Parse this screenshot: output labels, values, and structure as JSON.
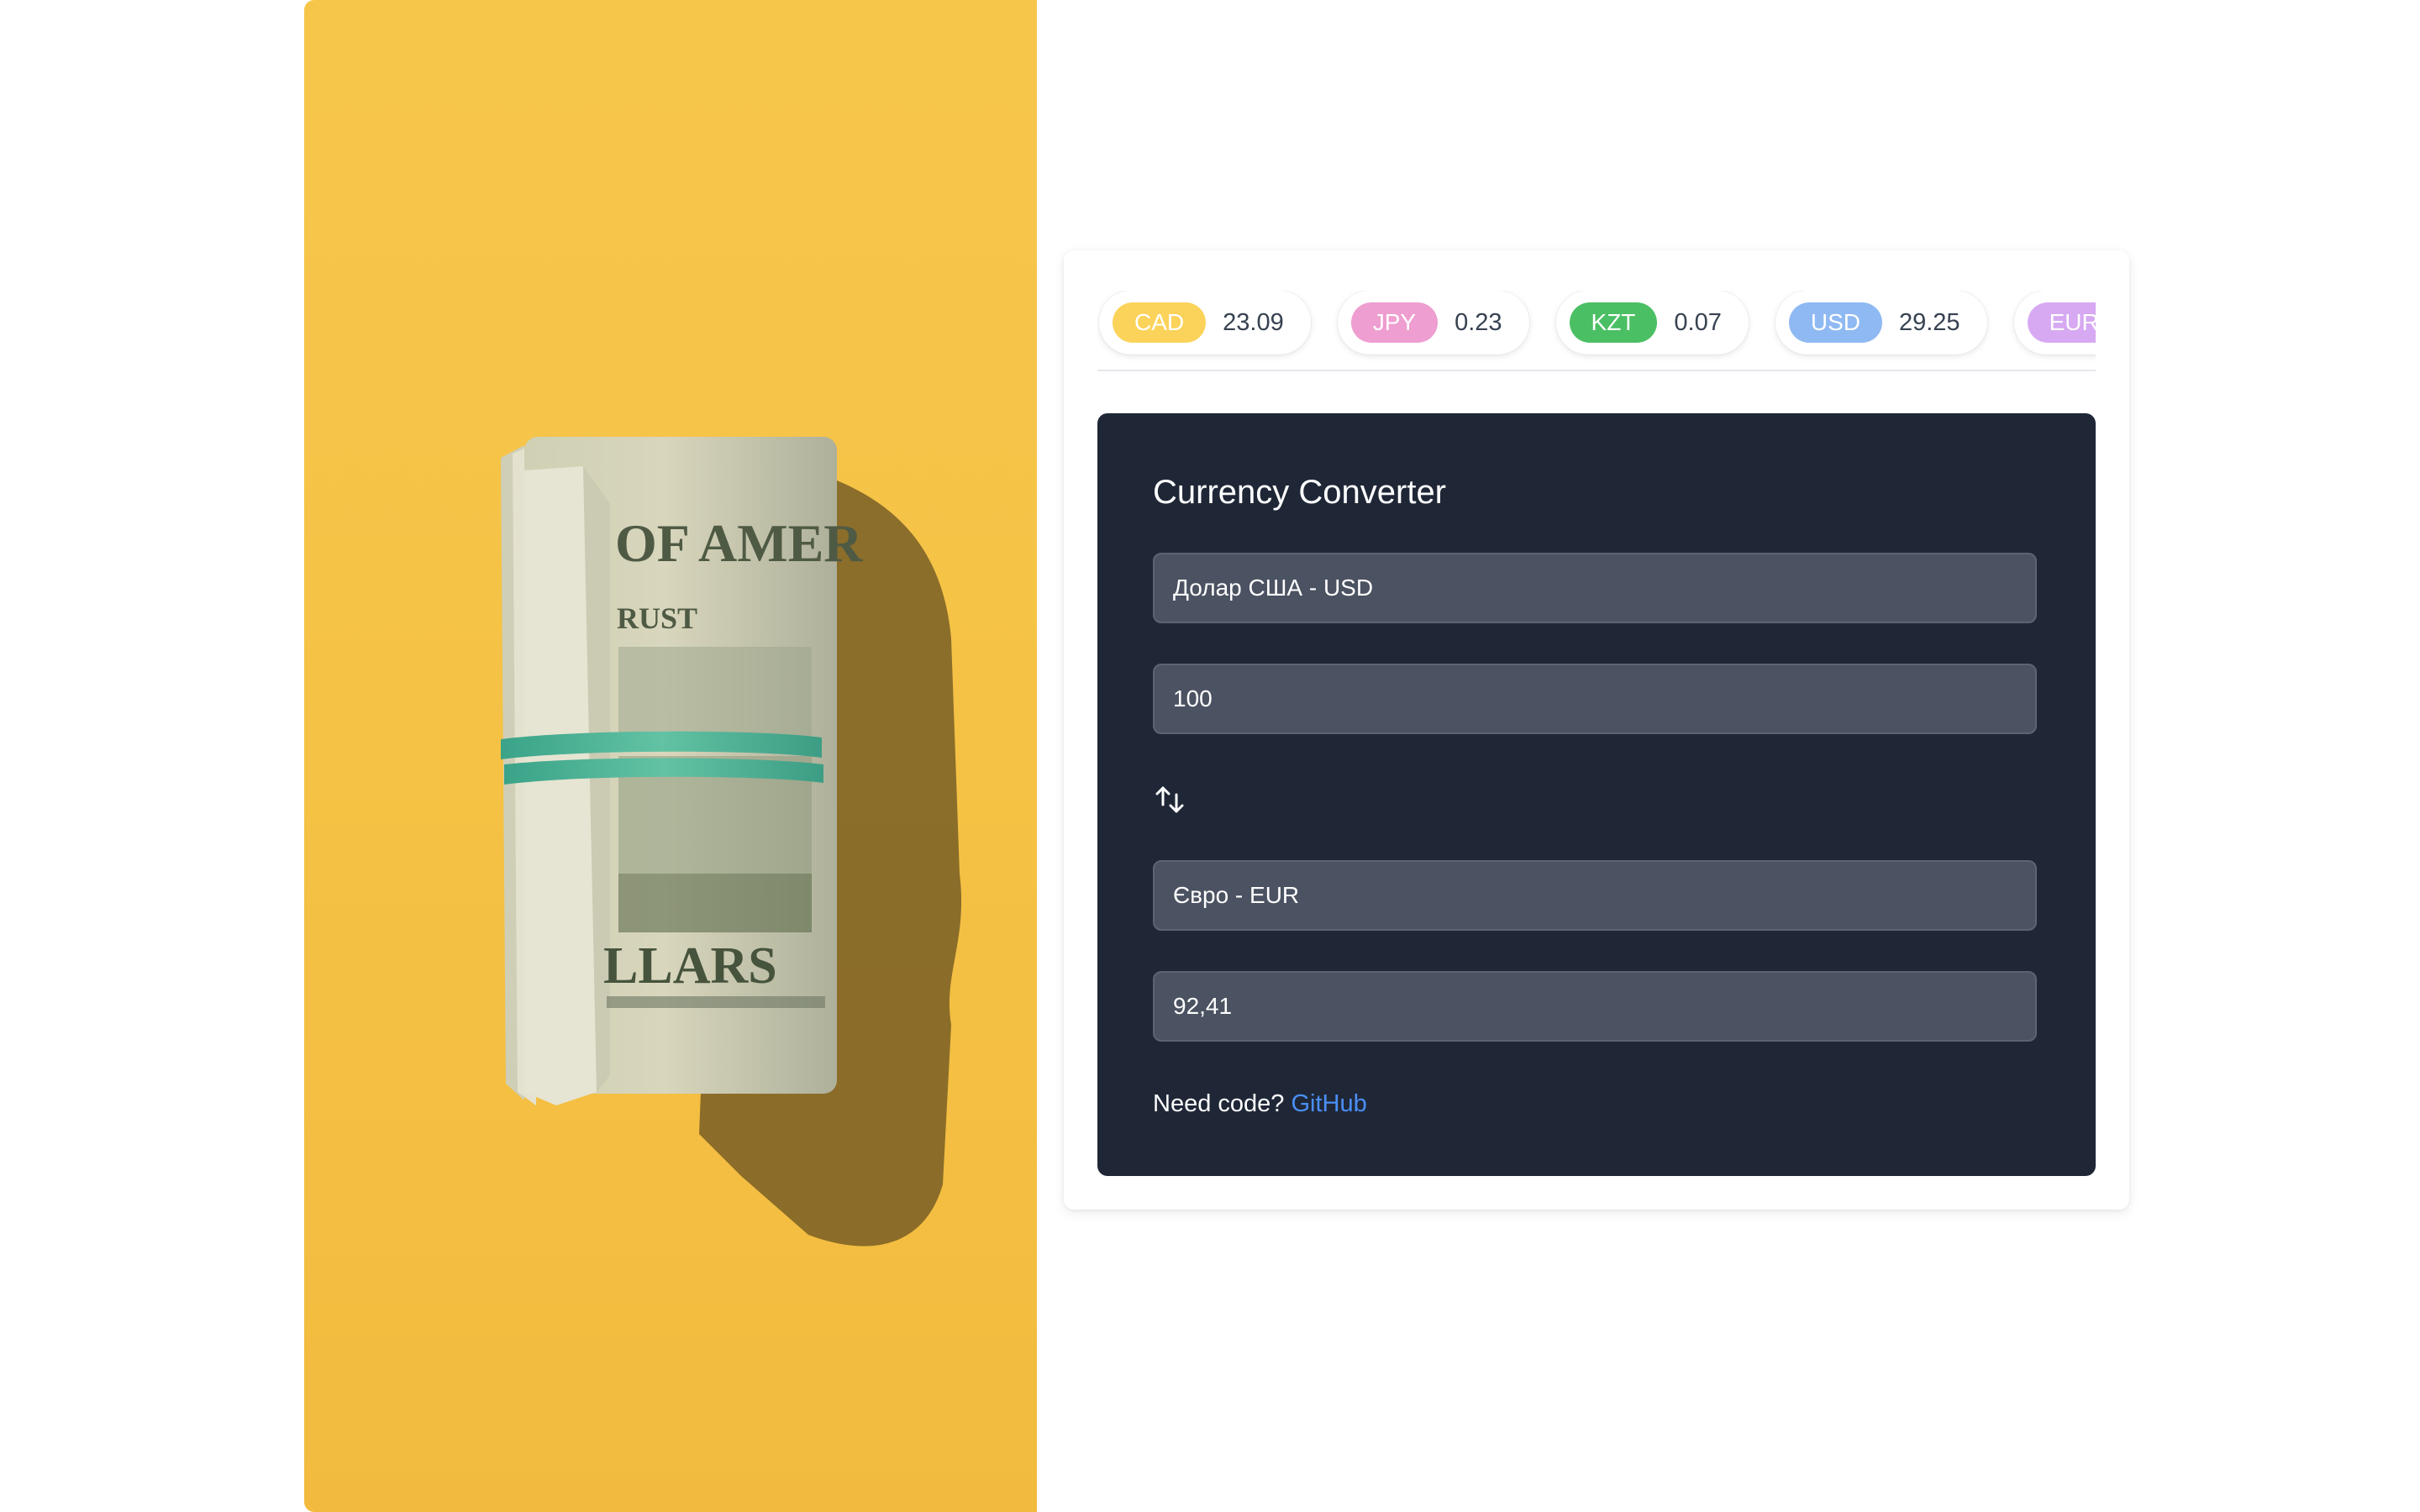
{
  "colors": {
    "hero_background": "#f4c44a",
    "panel_background": "#1f2737",
    "field_background": "#4b5261",
    "link": "#4a8ff5"
  },
  "hero": {
    "icon": "money-roll-photo"
  },
  "rates": [
    {
      "code": "CAD",
      "value": "23.09",
      "color": "#fbd35a"
    },
    {
      "code": "JPY",
      "value": "0.23",
      "color": "#ee9ed0"
    },
    {
      "code": "KZT",
      "value": "0.07",
      "color": "#4bbf63"
    },
    {
      "code": "USD",
      "value": "29.25",
      "color": "#8fb9f2"
    },
    {
      "code": "EUR",
      "value": "",
      "color": "#d7a9f2"
    }
  ],
  "converter": {
    "title": "Currency Converter",
    "from_currency": "Долар США - USD",
    "from_amount": "100",
    "swap_icon": "swap-vertical-arrows",
    "to_currency": "Євро - EUR",
    "to_amount": "92,41"
  },
  "footer": {
    "text": "Need code? ",
    "link_label": "GitHub"
  }
}
